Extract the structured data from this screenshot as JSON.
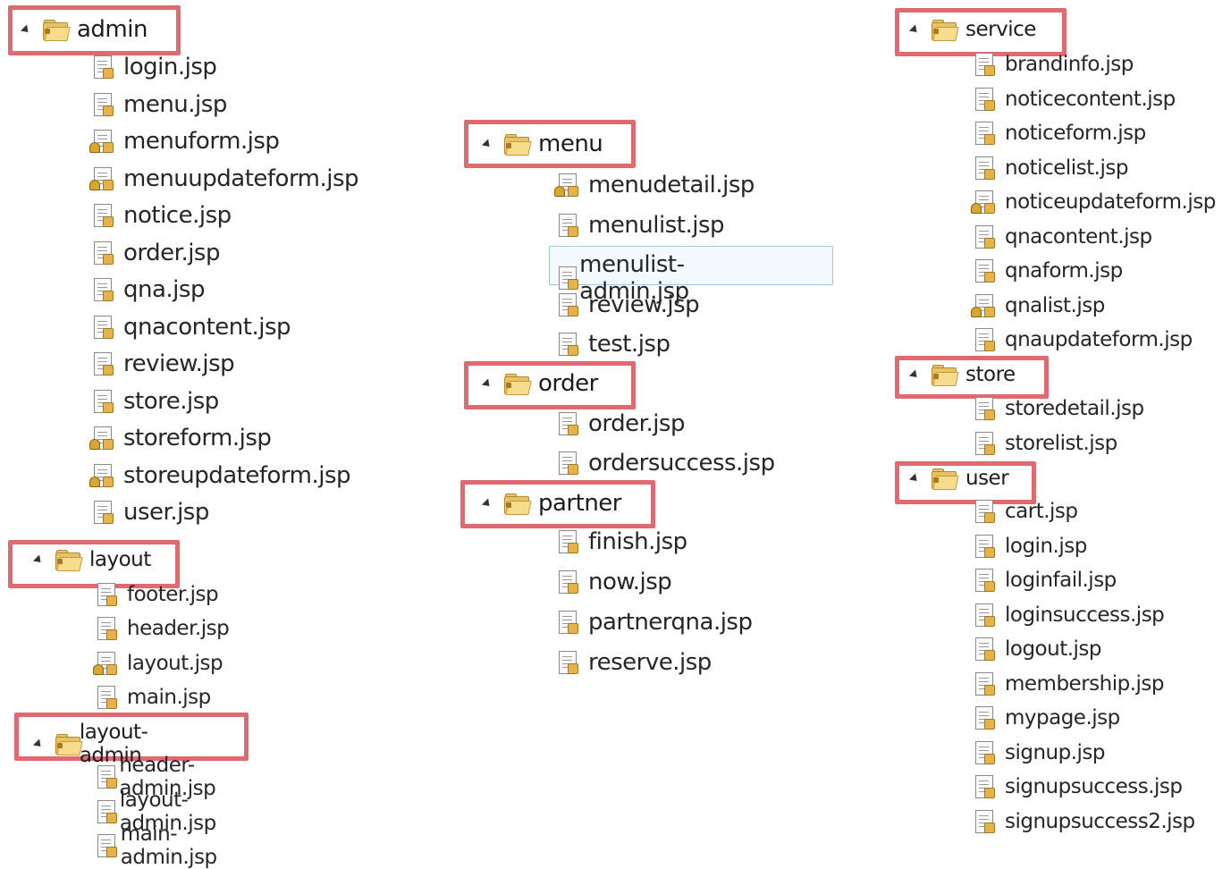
{
  "admin": {
    "name": "admin",
    "files": [
      "login.jsp",
      "menu.jsp",
      "menuform.jsp",
      "menuupdateform.jsp",
      "notice.jsp",
      "order.jsp",
      "qna.jsp",
      "qnacontent.jsp",
      "review.jsp",
      "store.jsp",
      "storeform.jsp",
      "storeupdateform.jsp",
      "user.jsp"
    ]
  },
  "layout": {
    "name": "layout",
    "files": [
      "footer.jsp",
      "header.jsp",
      "layout.jsp",
      "main.jsp"
    ]
  },
  "layout_admin": {
    "name": "layout-admin",
    "files": [
      "header-admin.jsp",
      "layout-admin.jsp",
      "main-admin.jsp"
    ]
  },
  "menu": {
    "name": "menu",
    "files": [
      "menudetail.jsp",
      "menulist.jsp",
      "menulist-admin.jsp",
      "review.jsp",
      "test.jsp"
    ]
  },
  "order": {
    "name": "order",
    "files": [
      "order.jsp",
      "ordersuccess.jsp"
    ]
  },
  "partner": {
    "name": "partner",
    "files": [
      "finish.jsp",
      "now.jsp",
      "partnerqna.jsp",
      "reserve.jsp"
    ]
  },
  "service": {
    "name": "service",
    "files": [
      "brandinfo.jsp",
      "noticecontent.jsp",
      "noticeform.jsp",
      "noticelist.jsp",
      "noticeupdateform.jsp",
      "qnacontent.jsp",
      "qnaform.jsp",
      "qnalist.jsp",
      "qnaupdateform.jsp"
    ]
  },
  "store": {
    "name": "store",
    "files": [
      "storedetail.jsp",
      "storelist.jsp"
    ]
  },
  "user": {
    "name": "user",
    "files": [
      "cart.jsp",
      "login.jsp",
      "loginfail.jsp",
      "loginsuccess.jsp",
      "logout.jsp",
      "membership.jsp",
      "mypage.jsp",
      "signup.jsp",
      "signupsuccess.jsp",
      "signupsuccess2.jsp"
    ]
  },
  "icons": {
    "folder": "package-folder-icon",
    "file": "jsp-file-icon",
    "expand": "expand-triangle-icon"
  },
  "colors": {
    "highlight_border": "#e06a6f",
    "selection_border": "#9cc7e8"
  },
  "selected_file": "menulist-admin.jsp",
  "warning_files": [
    "menuform.jsp",
    "menuupdateform.jsp",
    "storeform.jsp",
    "storeupdateform.jsp",
    "layout.jsp",
    "menudetail.jsp",
    "noticeupdateform.jsp",
    "qnalist.jsp"
  ]
}
